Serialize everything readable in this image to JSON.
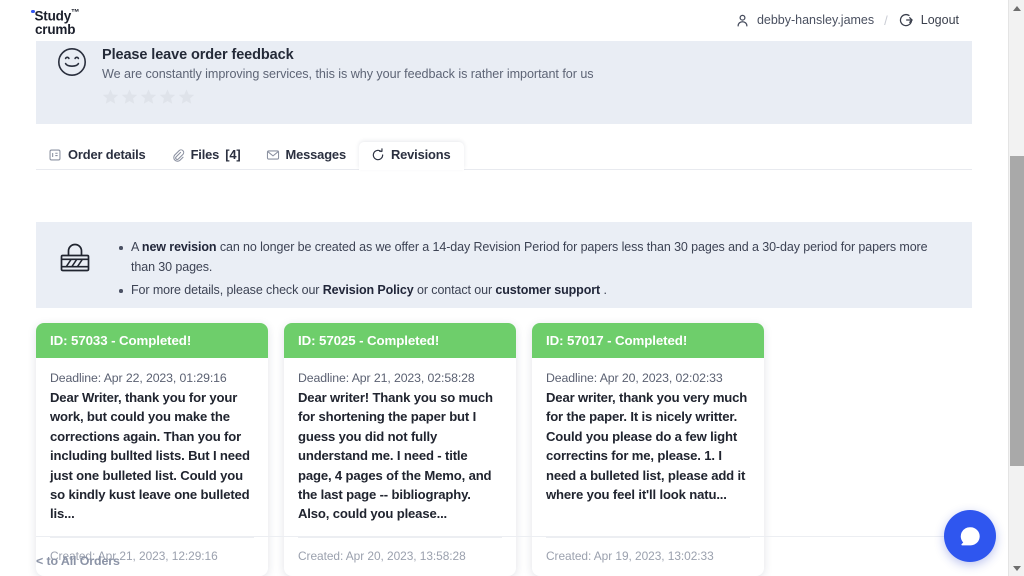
{
  "header": {
    "logo_line1": "Study",
    "logo_tm": "™",
    "logo_line2": "crumb",
    "user_icon": "person-icon",
    "user_name": "debby-hansley.james",
    "separator": "/",
    "logout_icon": "logout-icon",
    "logout_label": "Logout"
  },
  "feedback": {
    "icon": "smiley-face-icon",
    "title": "Please leave order feedback",
    "subtitle": "We are constantly improving services, this is why your feedback is rather important for us",
    "rating_stars": 5,
    "rating_value": 0,
    "star_color": "#dfe3ea"
  },
  "tabs": [
    {
      "label": "Order details",
      "icon": "order-details-icon",
      "active": false
    },
    {
      "label": "Files",
      "icon": "paperclip-icon",
      "count": "[4]",
      "active": false
    },
    {
      "label": "Messages",
      "icon": "envelope-icon",
      "active": false
    },
    {
      "label": "Revisions",
      "icon": "refresh-icon",
      "active": true
    }
  ],
  "notice": {
    "icon": "padlock-icon",
    "items": [
      {
        "p1": "A ",
        "b1": "new revision",
        "p2": " can no longer be created as we offer a 14-day Revision Period for papers less than 30 pages and a 30-day period for papers more than 30 pages.",
        "b2": "",
        "p3": ""
      },
      {
        "p1": "For more details, please check our ",
        "b1": "Revision Policy",
        "p2": " or contact our ",
        "b2": "customer support",
        "p3": " ."
      }
    ]
  },
  "revisions": {
    "status_color": "#6ece6b",
    "deadline_prefix": "Deadline: ",
    "created_prefix": "Created: ",
    "cards": [
      {
        "header": "ID: 57033 - Completed!",
        "deadline": "Deadline: Apr 22, 2023, 01:29:16",
        "message": "Dear Writer, thank you for your work, but could you make the corrections again. Than you for including bullted lists. But I need just one bulleted list. Could you so kindly kust leave one bulleted lis...",
        "created": "Created: Apr 21, 2023, 12:29:16"
      },
      {
        "header": "ID: 57025 - Completed!",
        "deadline": "Deadline: Apr 21, 2023, 02:58:28",
        "message": "Dear writer! Thank you so much for shortening the paper but I guess you did not fully understand me. I need - title page, 4 pages of the Memo, and the last page -- bibliography. Also, could you please...",
        "created": "Created: Apr 20, 2023, 13:58:28"
      },
      {
        "header": "ID: 57017 - Completed!",
        "deadline": "Deadline: Apr 20, 2023, 02:02:33",
        "message": "Dear writer, thank you very much for the paper. It is nicely writter. Could you please do a few light correctins for me, please. 1. I need a bulleted list, please add it where you feel it'll look natu...",
        "created": "Created: Apr 19, 2023, 13:02:33"
      }
    ]
  },
  "footer": {
    "back_link": "< to All Orders"
  },
  "chat": {
    "icon": "chat-bubble-icon",
    "color": "#2f56ef"
  },
  "scrollbar": {
    "up_arrow": "scroll-up-arrow",
    "down_arrow": "scroll-down-arrow"
  }
}
